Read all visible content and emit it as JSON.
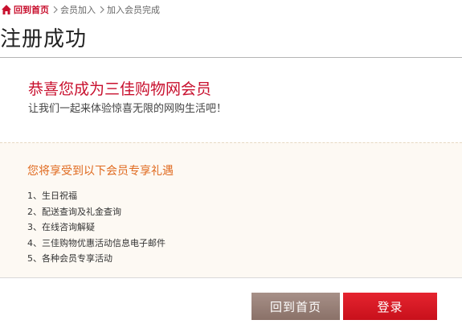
{
  "breadcrumb": {
    "home": "回到首页",
    "items": [
      "会员加入",
      "加入会员完成"
    ]
  },
  "page_title": "注册成功",
  "congrats": {
    "headline": "恭喜您成为三佳购物网会员",
    "subline": "让我们一起来体验惊喜无限的网购生活吧！"
  },
  "benefits": {
    "title": "您将享受到以下会员专享礼遇",
    "items": [
      "1、生日祝福",
      "2、配送查询及礼金查询",
      "3、在线咨询解疑",
      "4、三佳购物优惠活动信息电子邮件",
      "5、各种会员专享活动"
    ]
  },
  "buttons": {
    "home": "回到首页",
    "login": "登录"
  },
  "colors": {
    "accent_red": "#c8102e",
    "benefit_title_orange": "#e06a1f",
    "home_button": "#9b8178",
    "login_button": "#d71920"
  },
  "icons": {
    "home": "house-icon",
    "separator": "chevron-right-icon"
  }
}
